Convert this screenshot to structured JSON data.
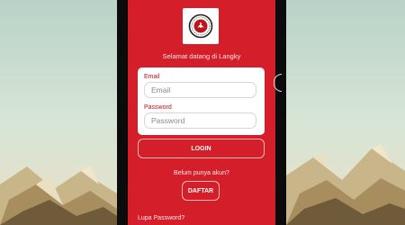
{
  "app": {
    "logo_icon": "langky-logo-icon",
    "welcome_text": "Selamat datang di Langky"
  },
  "login_form": {
    "email_label": "Email",
    "email_placeholder": "Email",
    "password_label": "Password",
    "password_placeholder": "Password",
    "login_button": "LOGIN"
  },
  "signup": {
    "question": "Belum punya akun?",
    "button": "DAFTAR"
  },
  "forgot_password": "Lupa Password?",
  "colors": {
    "brand_red": "#d41f2a",
    "label_red": "#b5121b",
    "card_white": "#ffffff"
  }
}
